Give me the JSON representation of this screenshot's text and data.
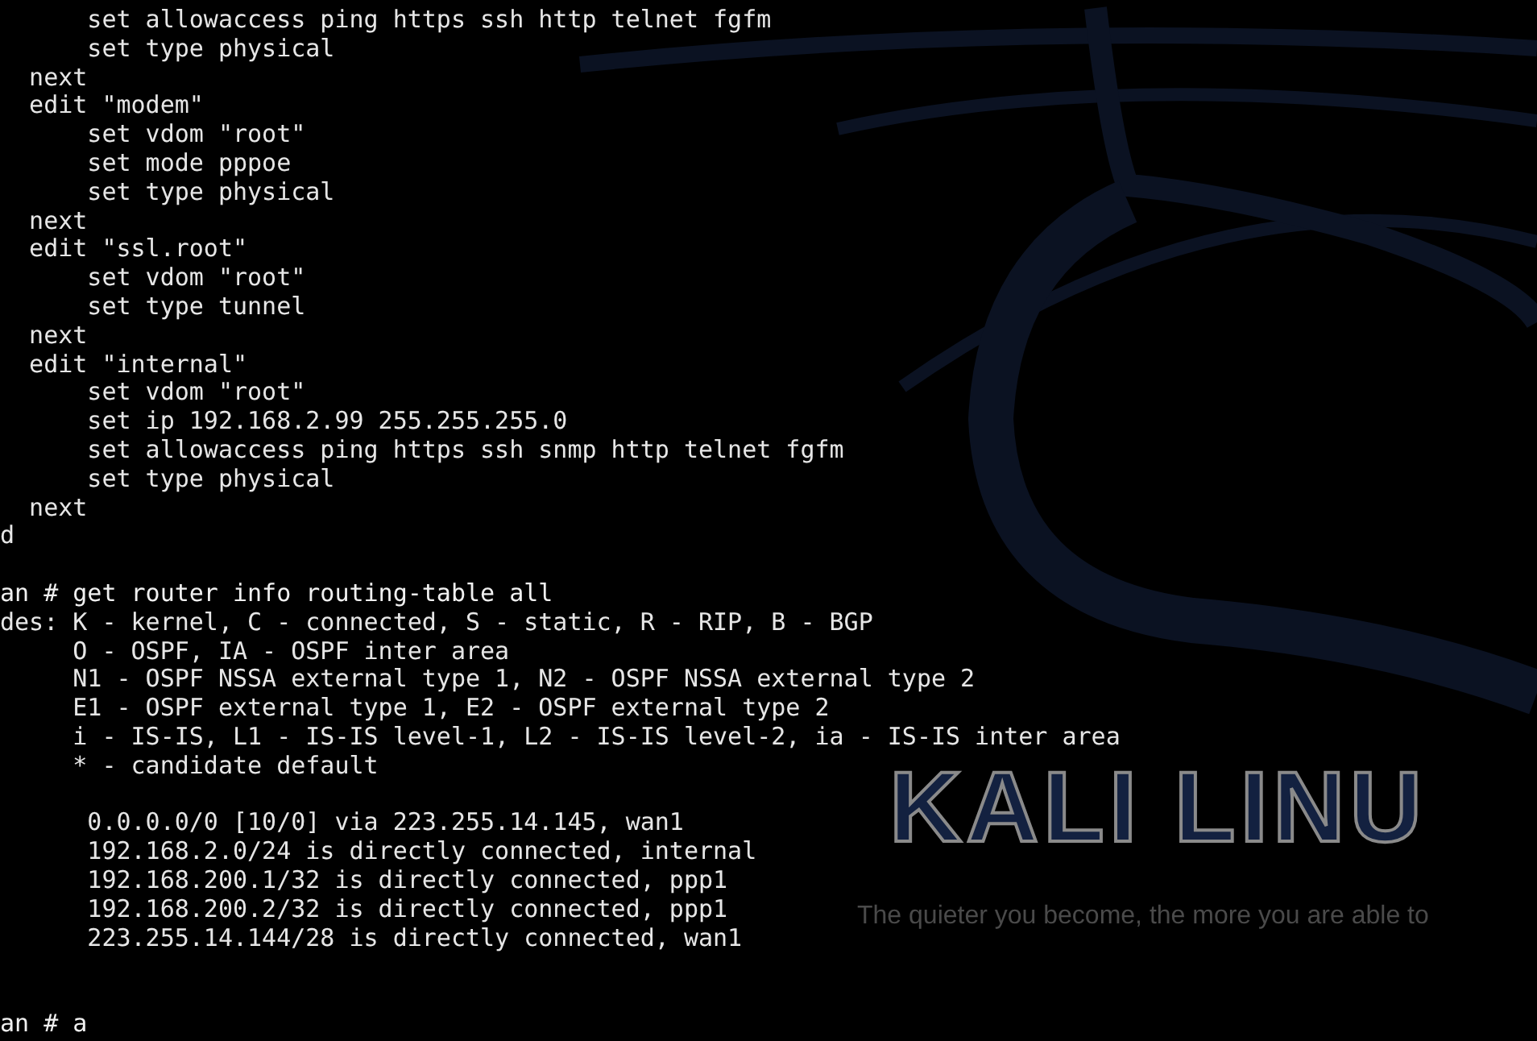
{
  "wallpaper": {
    "logo": "KALI LINU",
    "tagline": "The quieter you become, the more you are able to"
  },
  "terminal": {
    "lines": [
      {
        "kind": "text",
        "text": "      set allowaccess ping https ssh http telnet fgfm"
      },
      {
        "kind": "text",
        "text": "      set type physical"
      },
      {
        "kind": "text",
        "text": "  next"
      },
      {
        "kind": "text",
        "text": "  edit \"modem\""
      },
      {
        "kind": "text",
        "text": "      set vdom \"root\""
      },
      {
        "kind": "text",
        "text": "      set mode pppoe"
      },
      {
        "kind": "text",
        "text": "      set type physical"
      },
      {
        "kind": "text",
        "text": "  next"
      },
      {
        "kind": "text",
        "text": "  edit \"ssl.root\""
      },
      {
        "kind": "text",
        "text": "      set vdom \"root\""
      },
      {
        "kind": "text",
        "text": "      set type tunnel"
      },
      {
        "kind": "text",
        "text": "  next"
      },
      {
        "kind": "text",
        "text": "  edit \"internal\""
      },
      {
        "kind": "text",
        "text": "      set vdom \"root\""
      },
      {
        "kind": "text",
        "text": "      set ip 192.168.2.99 255.255.255.0"
      },
      {
        "kind": "text",
        "text": "      set allowaccess ping https ssh snmp http telnet fgfm"
      },
      {
        "kind": "text",
        "text": "      set type physical"
      },
      {
        "kind": "text",
        "text": "  next"
      },
      {
        "kind": "text",
        "text": "d"
      },
      {
        "kind": "blank"
      },
      {
        "kind": "prompt",
        "text": "an # get router info routing-table all"
      },
      {
        "kind": "text",
        "text": "des: K - kernel, C - connected, S - static, R - RIP, B - BGP"
      },
      {
        "kind": "text",
        "text": "     O - OSPF, IA - OSPF inter area"
      },
      {
        "kind": "text",
        "text": "     N1 - OSPF NSSA external type 1, N2 - OSPF NSSA external type 2"
      },
      {
        "kind": "text",
        "text": "     E1 - OSPF external type 1, E2 - OSPF external type 2"
      },
      {
        "kind": "text",
        "text": "     i - IS-IS, L1 - IS-IS level-1, L2 - IS-IS level-2, ia - IS-IS inter area"
      },
      {
        "kind": "text",
        "text": "     * - candidate default"
      },
      {
        "kind": "blank"
      },
      {
        "kind": "text",
        "text": "      0.0.0.0/0 [10/0] via 223.255.14.145, wan1"
      },
      {
        "kind": "text",
        "text": "      192.168.2.0/24 is directly connected, internal"
      },
      {
        "kind": "text",
        "text": "      192.168.200.1/32 is directly connected, ppp1"
      },
      {
        "kind": "text",
        "text": "      192.168.200.2/32 is directly connected, ppp1"
      },
      {
        "kind": "text",
        "text": "      223.255.14.144/28 is directly connected, wan1"
      },
      {
        "kind": "blank"
      },
      {
        "kind": "blank"
      },
      {
        "kind": "prompt",
        "text": "an # a"
      }
    ]
  }
}
